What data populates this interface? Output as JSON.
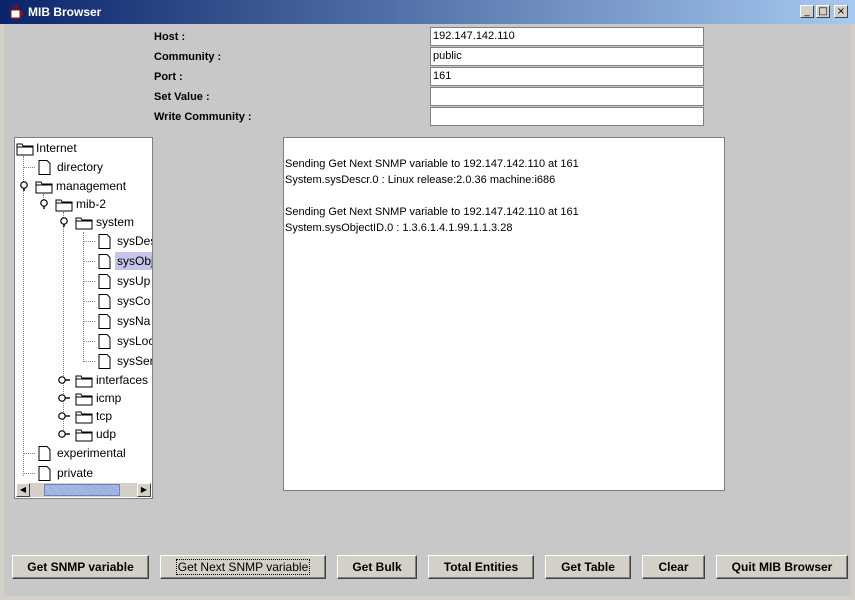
{
  "window": {
    "title": "MIB Browser",
    "controls": {
      "minimize": "_",
      "maximize": "□",
      "close": "×"
    }
  },
  "form": {
    "host_label": "Host :",
    "host_value": "192.147.142.110",
    "community_label": "Community :",
    "community_value": "public",
    "port_label": "Port :",
    "port_value": "161",
    "set_value_label": "Set Value :",
    "set_value_value": "",
    "write_community_label": "Write Community :",
    "write_community_value": ""
  },
  "tree": {
    "root": "Internet",
    "directory": "directory",
    "management": "management",
    "mib2": "mib-2",
    "system": "system",
    "system_children": [
      "sysDes",
      "sysObj",
      "sysUp",
      "sysCo",
      "sysNa",
      "sysLoc",
      "sysSer"
    ],
    "interfaces": "interfaces",
    "icmp": "icmp",
    "tcp": "tcp",
    "udp": "udp",
    "experimental": "experimental",
    "private": "private",
    "selected": "sysObj"
  },
  "output": {
    "lines": [
      "Sending Get Next SNMP variable to 192.147.142.110 at 161",
      "System.sysDescr.0 : Linux release:2.0.36 machine:i686",
      "",
      "Sending Get Next SNMP variable to 192.147.142.110 at 161",
      "System.sysObjectID.0 : 1.3.6.1.4.1.99.1.1.3.28"
    ]
  },
  "buttons": {
    "get_snmp": "Get SNMP variable",
    "get_next": "Get Next SNMP variable",
    "get_bulk": "Get Bulk",
    "total_entities": "Total Entities",
    "get_table": "Get Table",
    "clear": "Clear",
    "quit": "Quit MIB Browser"
  },
  "icons": {
    "app": "java-coffee-icon",
    "folder": "folder-icon",
    "document": "document-icon",
    "expanded": "expanded-toggle-icon",
    "collapsed": "collapsed-toggle-icon"
  },
  "colors": {
    "title_bar_start": "#0a246a",
    "title_bar_end": "#a6caf0",
    "background": "#c8c8c8",
    "selection": "#c5c5ea"
  }
}
